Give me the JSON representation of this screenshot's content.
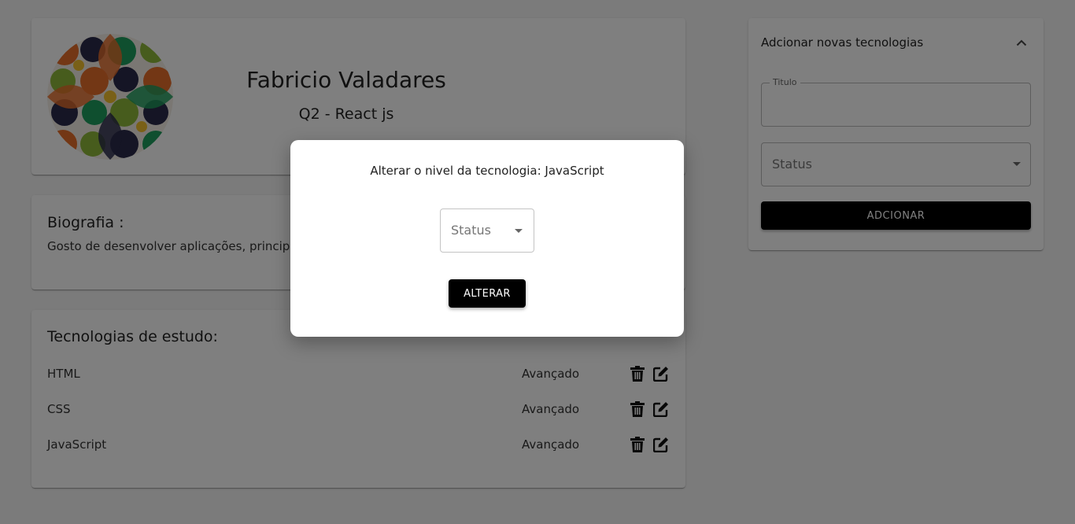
{
  "profile": {
    "name": "Fabricio Valadares",
    "course_module": "Q2 - React js"
  },
  "bio": {
    "title": "Biografia :",
    "text": "Gosto de desenvolver aplicações, principalmente aquelas que resolvem problemas do dia a dia."
  },
  "technologies": {
    "title": "Tecnologias de estudo:",
    "items": [
      {
        "name": "HTML",
        "status": "Avançado"
      },
      {
        "name": "CSS",
        "status": "Avançado"
      },
      {
        "name": "JavaScript",
        "status": "Avançado"
      }
    ]
  },
  "add_tech": {
    "title": "Adcionar novas tecnologias",
    "title_field_label": "Titulo",
    "title_field_value": "",
    "status_placeholder": "Status",
    "button_label": "ADCIONAR"
  },
  "modal": {
    "title": "Alterar o nivel da tecnologia: JavaScript",
    "status_placeholder": "Status",
    "button_label": "ALTERAR"
  },
  "icons": {
    "delete": "trash-icon",
    "edit": "edit-icon",
    "collapse": "chevron-up-icon",
    "select": "caret-down-icon"
  },
  "colors": {
    "background": "#f7f7f7",
    "button": "#000000",
    "backdrop": "rgba(0,0,0,0.5)"
  }
}
